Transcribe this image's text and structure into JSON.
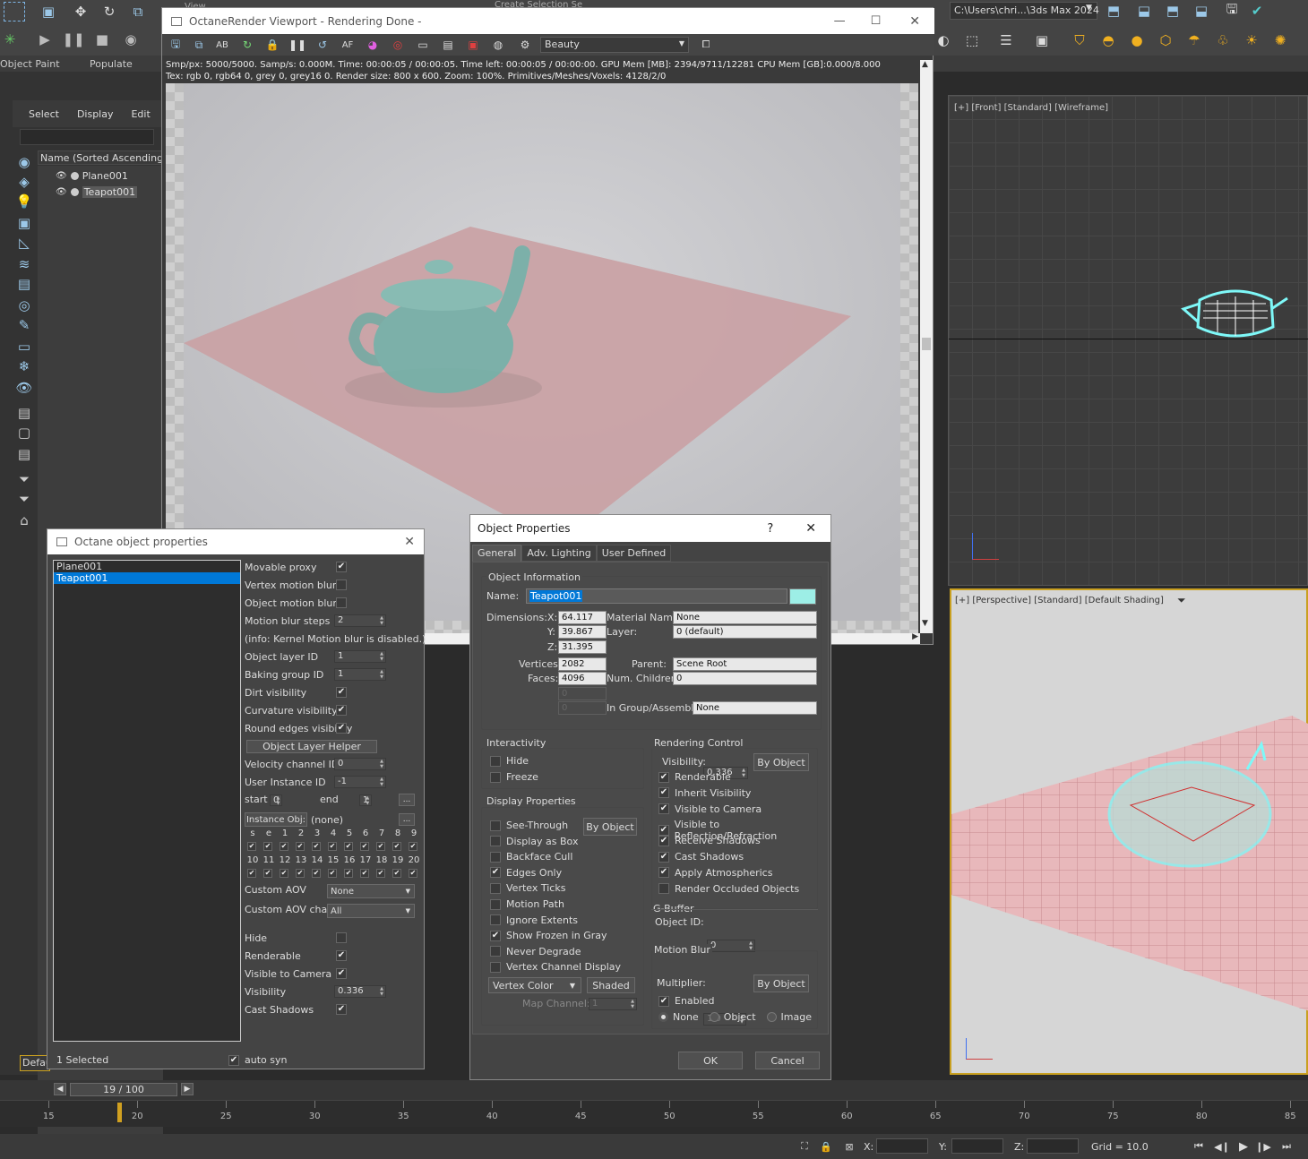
{
  "ribbon": {
    "object_paint": "Object Paint",
    "populate": "Populate",
    "view_label": "View",
    "selection_set": "Create Selection Se",
    "path": "C:\\Users\\chri...\\3ds Max 2024"
  },
  "explorer": {
    "menu": [
      "Select",
      "Display",
      "Edit"
    ],
    "column": "Name (Sorted Ascending)",
    "items": [
      "Plane001",
      "Teapot001"
    ],
    "layer_btn": "Defau"
  },
  "octane_viewport": {
    "title": "OctaneRender Viewport - Rendering Done -",
    "pass": "Beauty",
    "stats1": "Smp/px: 5000/5000.   Samp/s: 0.000M.   Time: 00:00:05 / 00:00:05.   Time left: 00:00:05 / 00:00:00.   GPU Mem [MB]: 2394/9711/12281   CPU Mem [GB]:0.000/8.000",
    "stats2": "Tex: rgb 0, rgb64 0, grey 0, grey16 0.   Render size: 800 x 600.   Zoom: 100%.   Primitives/Meshes/Voxels: 4128/2/0",
    "colors": {
      "bg": "#c6c6c9",
      "plane": "#c9a2a5",
      "teapot": "#6fb3aa"
    }
  },
  "viewports": {
    "front": "[+] [Front] [Standard] [Wireframe]",
    "perspective": "[+] [Perspective] [Standard] [Default Shading]"
  },
  "octane_props": {
    "title": "Octane object properties",
    "list": [
      "Plane001",
      "Teapot001"
    ],
    "selected_count": "1 Selected",
    "auto_sync": "auto syn",
    "rows": [
      {
        "label": "Movable proxy",
        "type": "check",
        "value": true
      },
      {
        "label": "Vertex motion blur",
        "type": "check",
        "value": false
      },
      {
        "label": "Object motion blur",
        "type": "check",
        "value": false
      },
      {
        "label": "Motion blur steps",
        "type": "spin",
        "value": "2"
      },
      {
        "label": "(info: Kernel Motion blur is disabled.)",
        "type": "text"
      },
      {
        "label": "Object layer ID",
        "type": "spin",
        "value": "1"
      },
      {
        "label": "Baking group ID",
        "type": "spin",
        "value": "1"
      },
      {
        "label": "Dirt visibility",
        "type": "check",
        "value": true
      },
      {
        "label": "Curvature visibility",
        "type": "check",
        "value": true
      },
      {
        "label": "Round edges visibility",
        "type": "check",
        "value": true
      },
      {
        "label": "Object Layer Helper",
        "type": "button"
      },
      {
        "label": "Velocity channel ID",
        "type": "spin",
        "value": "0"
      },
      {
        "label": "User Instance ID",
        "type": "spin",
        "value": "-1"
      }
    ],
    "start_label": "start",
    "start_value": "0",
    "end_label": "end",
    "end_value": "1",
    "more": "...",
    "instance_btn": "Instance Obj:",
    "instance_value": "(none)",
    "grid_row1": [
      "s",
      "e",
      "1",
      "2",
      "3",
      "4",
      "5",
      "6",
      "7",
      "8",
      "9"
    ],
    "grid_row2": [
      "10",
      "11",
      "12",
      "13",
      "14",
      "15",
      "16",
      "17",
      "18",
      "19",
      "20"
    ],
    "custom_aov_label": "Custom AOV",
    "custom_aov": "None",
    "custom_aov_chan_label": "Custom AOV chan.",
    "custom_aov_chan": "All",
    "bottom_rows": [
      {
        "label": "Hide",
        "type": "check",
        "value": false
      },
      {
        "label": "Renderable",
        "type": "check",
        "value": true
      },
      {
        "label": "Visible to Camera",
        "type": "check",
        "value": true
      },
      {
        "label": "Visibility",
        "type": "spin",
        "value": "0.336"
      },
      {
        "label": "Cast Shadows",
        "type": "check",
        "value": true
      }
    ]
  },
  "obj_props": {
    "title": "Object Properties",
    "help": "?",
    "tabs": [
      "General",
      "Adv. Lighting",
      "User Defined"
    ],
    "info_group": "Object Information",
    "name_label": "Name:",
    "name_value": "Teapot001",
    "color": "#9deee6",
    "dimensions_label": "Dimensions:",
    "x_label": "X:",
    "x": "64.117",
    "y_label": "Y:",
    "y": "39.867",
    "z_label": "Z:",
    "z": "31.395",
    "vertices_label": "Vertices:",
    "vertices": "2082",
    "faces_label": "Faces:",
    "faces": "4096",
    "blank1": "0",
    "blank2": "0",
    "material_label": "Material Name:",
    "material": "None",
    "layer_label": "Layer:",
    "layer": "0 (default)",
    "parent_label": "Parent:",
    "parent": "Scene Root",
    "children_label": "Num. Children:",
    "children": "0",
    "group_label": "In Group/Assembly:",
    "group": "None",
    "interactivity": "Interactivity",
    "hide": "Hide",
    "freeze": "Freeze",
    "display_props": "Display Properties",
    "by_object": "By Object",
    "display_items": [
      {
        "label": "See-Through",
        "on": false
      },
      {
        "label": "Display as Box",
        "on": false
      },
      {
        "label": "Backface Cull",
        "on": false
      },
      {
        "label": "Edges Only",
        "on": true
      },
      {
        "label": "Vertex Ticks",
        "on": false
      },
      {
        "label": "Motion Path",
        "on": false
      },
      {
        "label": "Ignore Extents",
        "on": false
      },
      {
        "label": "Show Frozen in Gray",
        "on": true
      },
      {
        "label": "Never Degrade",
        "on": false
      },
      {
        "label": "Vertex Channel Display",
        "on": false
      }
    ],
    "vertex_color": "Vertex Color",
    "shaded": "Shaded",
    "map_channel_label": "Map Channel:",
    "map_channel": "1",
    "rendering_control": "Rendering Control",
    "visibility_label": "Visibility:",
    "visibility": "0.336",
    "render_items": [
      {
        "label": "Renderable",
        "on": true
      },
      {
        "label": "Inherit Visibility",
        "on": true
      },
      {
        "label": "Visible to Camera",
        "on": true
      },
      {
        "label": "Visible to Reflection/Refraction",
        "on": true
      },
      {
        "label": "Receive Shadows",
        "on": true
      },
      {
        "label": "Cast Shadows",
        "on": true
      },
      {
        "label": "Apply Atmospherics",
        "on": true
      },
      {
        "label": "Render Occluded Objects",
        "on": false
      }
    ],
    "gbuffer": "G-Buffer",
    "object_id_label": "Object ID:",
    "object_id": "0",
    "motion_blur": "Motion Blur",
    "multiplier_label": "Multiplier:",
    "multiplier": "1.0",
    "enabled": "Enabled",
    "radio": [
      "None",
      "Object",
      "Image"
    ],
    "ok": "OK",
    "cancel": "Cancel"
  },
  "timeline": {
    "frame": "19 / 100",
    "ticks": [
      "15",
      "20",
      "25",
      "30",
      "35",
      "40",
      "45",
      "50",
      "55",
      "60",
      "65",
      "70",
      "75",
      "80",
      "85"
    ],
    "current": 19
  },
  "status": {
    "x": "X:",
    "y": "Y:",
    "z": "Z:",
    "grid": "Grid = 10.0"
  }
}
